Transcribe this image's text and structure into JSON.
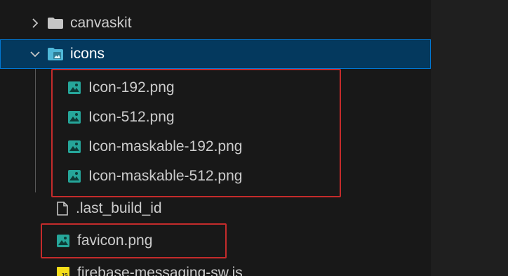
{
  "explorer": {
    "folders": {
      "canvaskit": "canvaskit",
      "icons": "icons"
    },
    "icon_files": [
      {
        "label": "Icon-192.png"
      },
      {
        "label": "Icon-512.png"
      },
      {
        "label": "Icon-maskable-192.png"
      },
      {
        "label": "Icon-maskable-512.png"
      }
    ],
    "files": {
      "last_build_id": ".last_build_id",
      "favicon": "favicon.png",
      "firebase_sw": "firebase-messaging-sw.js"
    }
  },
  "colors": {
    "selection_bg": "#04395e",
    "selection_border": "#0078d4",
    "highlight_box": "#c42b2b",
    "image_icon": "#26a69a",
    "folder_icon": "#c5c5c5",
    "js_icon": "#f5de19"
  }
}
